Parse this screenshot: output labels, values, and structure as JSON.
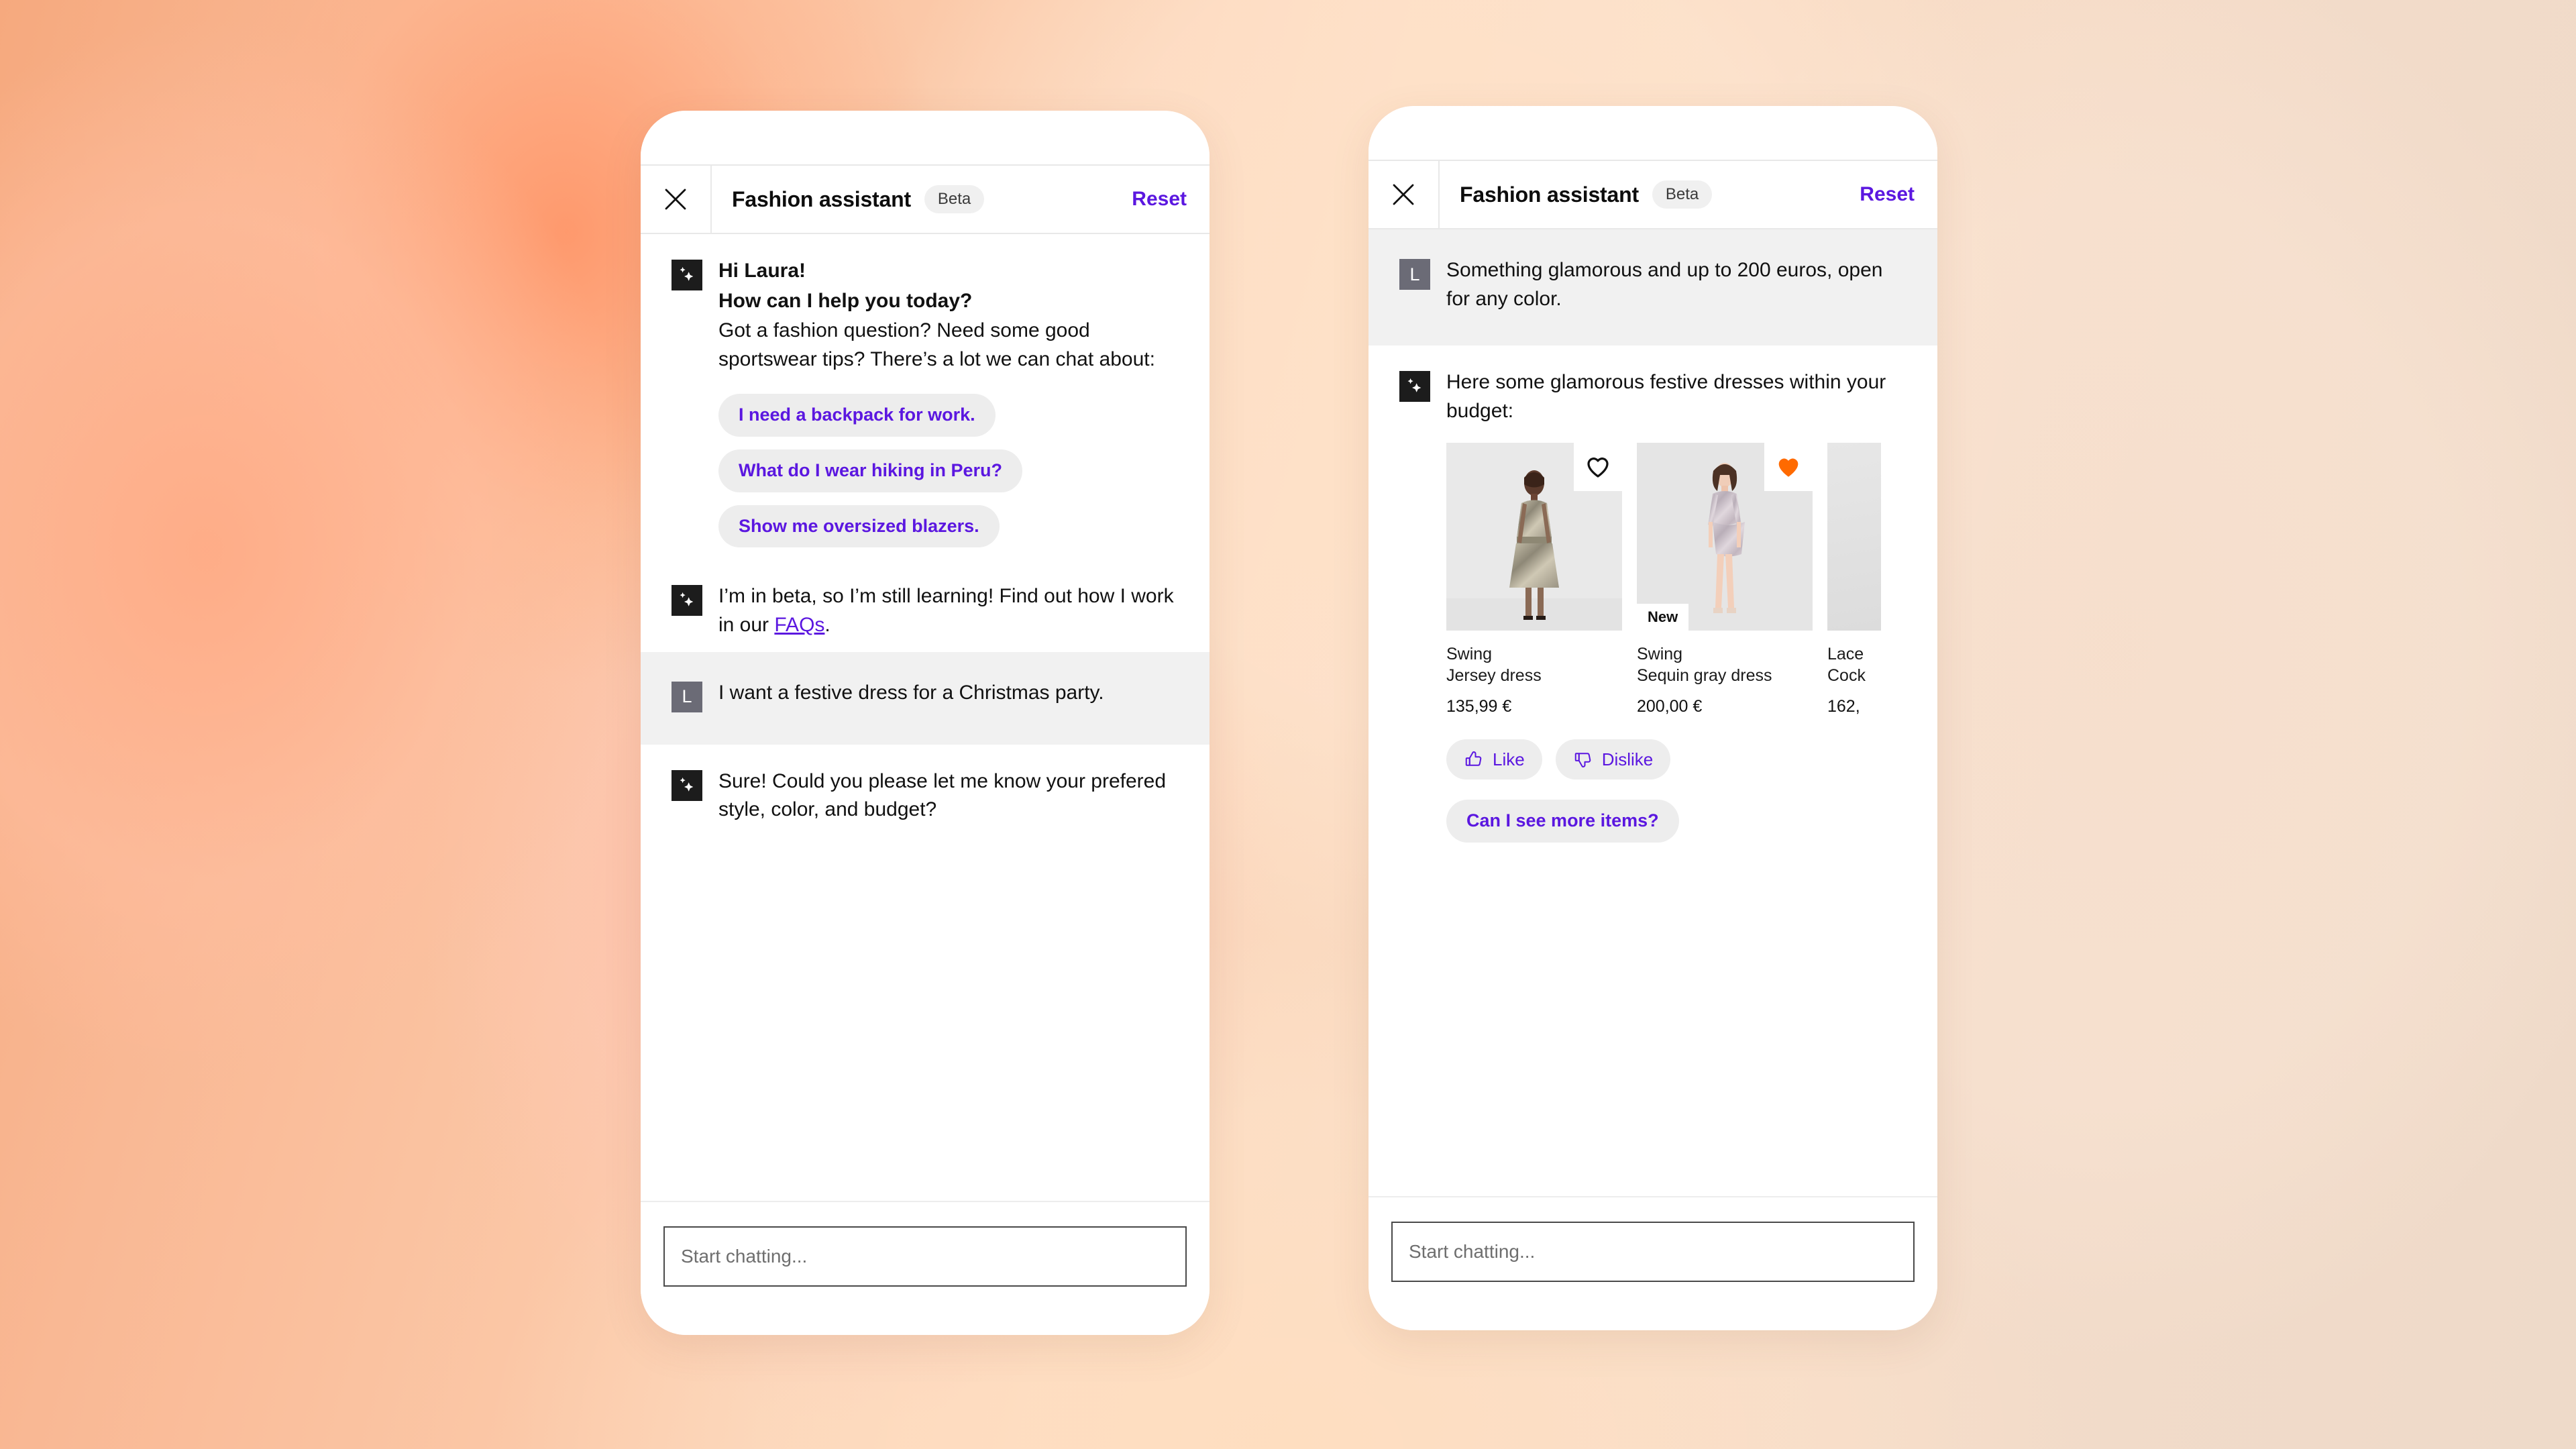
{
  "header": {
    "close_icon": "close-icon",
    "title": "Fashion assistant",
    "beta_label": "Beta",
    "reset_label": "Reset"
  },
  "composer": {
    "placeholder": "Start chatting...",
    "value": ""
  },
  "colors": {
    "accent_purple": "#5b17e0",
    "heart_active": "#ff6a00",
    "user_bubble_bg": "#f1f1f1",
    "chip_bg": "#ededed",
    "bot_avatar_bg": "#1c1c1c",
    "user_avatar_bg": "#6b6b76"
  },
  "phone_one": {
    "greeting": {
      "avatar": "sparkle-icon",
      "line_1": "Hi Laura!",
      "line_2": "How can I help you today?",
      "body": "Got a fashion question? Need some good sportswear tips? There’s a lot we can chat about:",
      "chips": [
        "I need a backpack for work.",
        "What do I wear hiking in Peru?",
        "Show me oversized blazers."
      ]
    },
    "beta_notice": {
      "avatar": "sparkle-icon",
      "text_before": "I’m in beta, so I’m still learning! Find out how I work in our ",
      "link_label": "FAQs",
      "text_after": "."
    },
    "user_message": {
      "avatar_initial": "L",
      "text": "I want a festive dress for a Christmas party."
    },
    "assistant_reply": {
      "avatar": "sparkle-icon",
      "text": "Sure! Could you please let me know your prefered style, color, and budget?"
    }
  },
  "phone_two": {
    "user_message": {
      "avatar_initial": "L",
      "text": "Something glamorous and up to 200 euros, open for any color."
    },
    "assistant_reply": {
      "avatar": "sparkle-icon",
      "text": "Here some glamorous festive dresses within your budget:"
    },
    "products": [
      {
        "brand": "Swing",
        "name": "Jersey dress",
        "price": "135,99 €",
        "favorited": false,
        "heart_icon": "heart-outline-icon",
        "badge": null
      },
      {
        "brand": "Swing",
        "name": "Sequin gray dress",
        "price": "200,00 €",
        "favorited": true,
        "heart_icon": "heart-filled-icon",
        "badge": "New"
      },
      {
        "brand": "Lace",
        "name": "Cock",
        "price": "162,",
        "favorited": false,
        "heart_icon": "heart-outline-icon",
        "badge": null
      }
    ],
    "feedback": {
      "like_label": "Like",
      "like_icon": "thumbs-up-icon",
      "dislike_label": "Dislike",
      "dislike_icon": "thumbs-down-icon"
    },
    "follow_up_chip": "Can I see more items?"
  }
}
